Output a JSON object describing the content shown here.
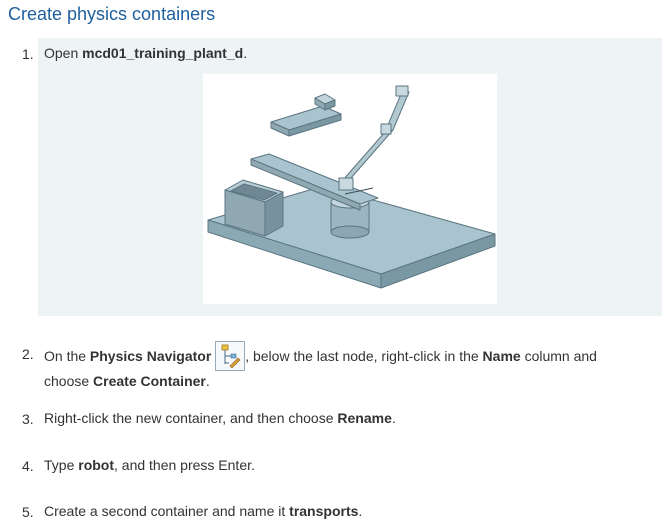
{
  "title": "Create physics containers",
  "steps": [
    {
      "num": "1.",
      "pre": "Open ",
      "bold": "mcd01_training_plant_d",
      "post": "."
    },
    {
      "num": "2.",
      "pre": "On the ",
      "bold1": "Physics Navigator",
      "mid1": ", below the last node, right-click in the ",
      "bold2": "Name",
      "mid2": " column and",
      "line2_pre": "choose ",
      "bold3": "Create Container",
      "post": "."
    },
    {
      "num": "3.",
      "pre": "Right-click the new container, and then choose ",
      "bold": "Rename",
      "post": "."
    },
    {
      "num": "4.",
      "pre": "Type ",
      "bold": "robot",
      "post": ", and then press Enter."
    },
    {
      "num": "5.",
      "pre": "Create a second container and name it ",
      "bold": "transports",
      "post": "."
    }
  ],
  "icons": {
    "physics_navigator": "physics-navigator-icon"
  },
  "colors": {
    "title": "#1f5f9e",
    "panel": "#eef4f6",
    "model_fill": "#a9c4cf",
    "model_stroke": "#5b7580"
  }
}
